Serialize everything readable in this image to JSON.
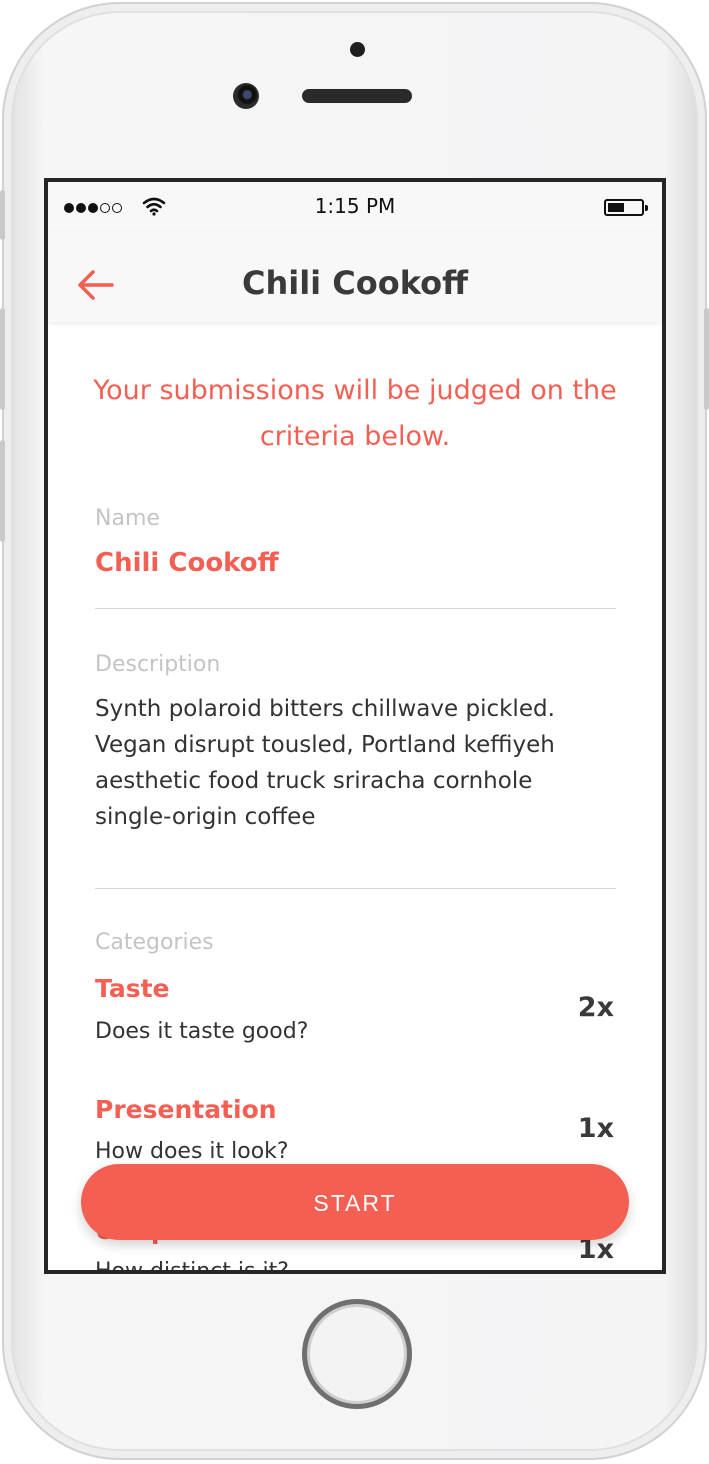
{
  "status_bar": {
    "time": "1:15 PM"
  },
  "nav": {
    "title": "Chili Cookoff"
  },
  "intro": "Your submissions will be judged on the criteria below.",
  "fields": {
    "name_label": "Name",
    "name_value": "Chili Cookoff",
    "description_label": "Description",
    "description_lines": [
      "Synth polaroid bitters chillwave pickled.",
      "Vegan disrupt tousled, Portland keffiyeh",
      "aesthetic food truck sriracha cornhole",
      "single-origin coffee"
    ],
    "categories_label": "Categories"
  },
  "categories": [
    {
      "title": "Taste",
      "description": "Does it taste good?",
      "weight": "2x"
    },
    {
      "title": "Presentation",
      "description": "How does it look?",
      "weight": "1x"
    },
    {
      "title": "Uniqueness",
      "description": "How distinct is it?",
      "weight": "1x"
    }
  ],
  "start_label": "START",
  "colors": {
    "accent": "#f45f53",
    "title": "#3a3a3a"
  }
}
